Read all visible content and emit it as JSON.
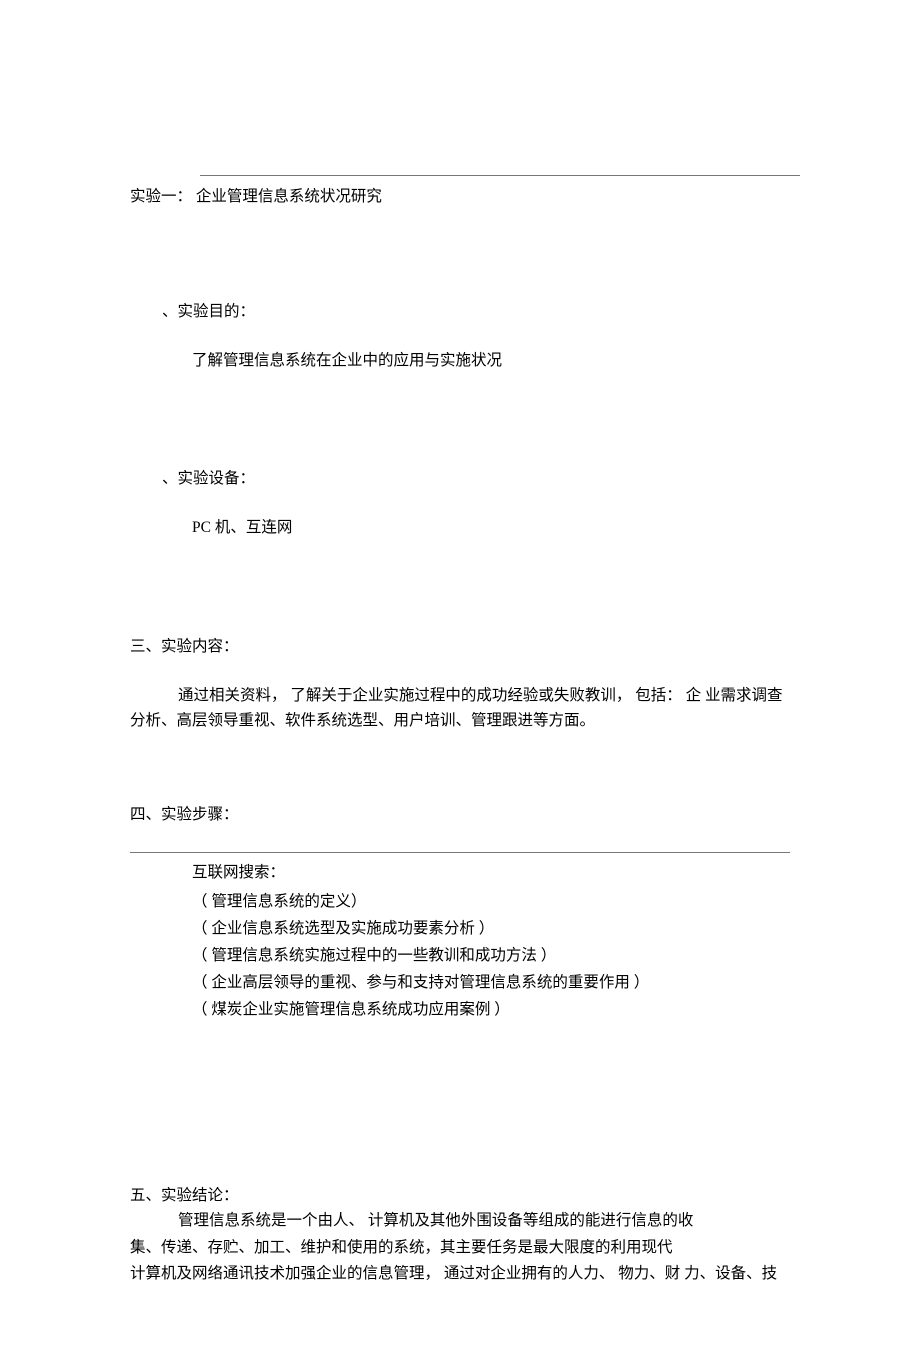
{
  "title": "实验一：   企业管理信息系统状况研究",
  "section1": {
    "label": "、实验目的：",
    "body": "了解管理信息系统在企业中的应用与实施状况"
  },
  "section2": {
    "label": "、实验设备：",
    "body": "PC 机、互连网"
  },
  "section3": {
    "label": "三、实验内容：",
    "body": "通过相关资料，  了解关于企业实施过程中的成功经验或失败教训，  包括：  企 业需求调查分析、高层领导重视、软件系统选型、用户培训、管理跟进等方面。"
  },
  "section4": {
    "label": "四、实验步骤：",
    "intro": "互联网搜索：",
    "items": [
      "（ 管理信息系统的定义）",
      "（ 企业信息系统选型及实施成功要素分析  ）",
      "（ 管理信息系统实施过程中的一些教训和成功方法  ）",
      "（ 企业高层领导的重视、参与和支持对管理信息系统的重要作用  ）",
      "（ 煤炭企业实施管理信息系统成功应用案例  ）"
    ]
  },
  "section5": {
    "label": "五、实验结论：",
    "p1": "管理信息系统是一个由人、  计算机及其他外围设备等组成的能进行信息的收",
    "p2": "集、传递、存贮、加工、维护和使用的系统，其主要任务是最大限度的利用现代",
    "p3": "计算机及网络通讯技术加强企业的信息管理，  通过对企业拥有的人力、 物力、财 力、设备、技"
  }
}
